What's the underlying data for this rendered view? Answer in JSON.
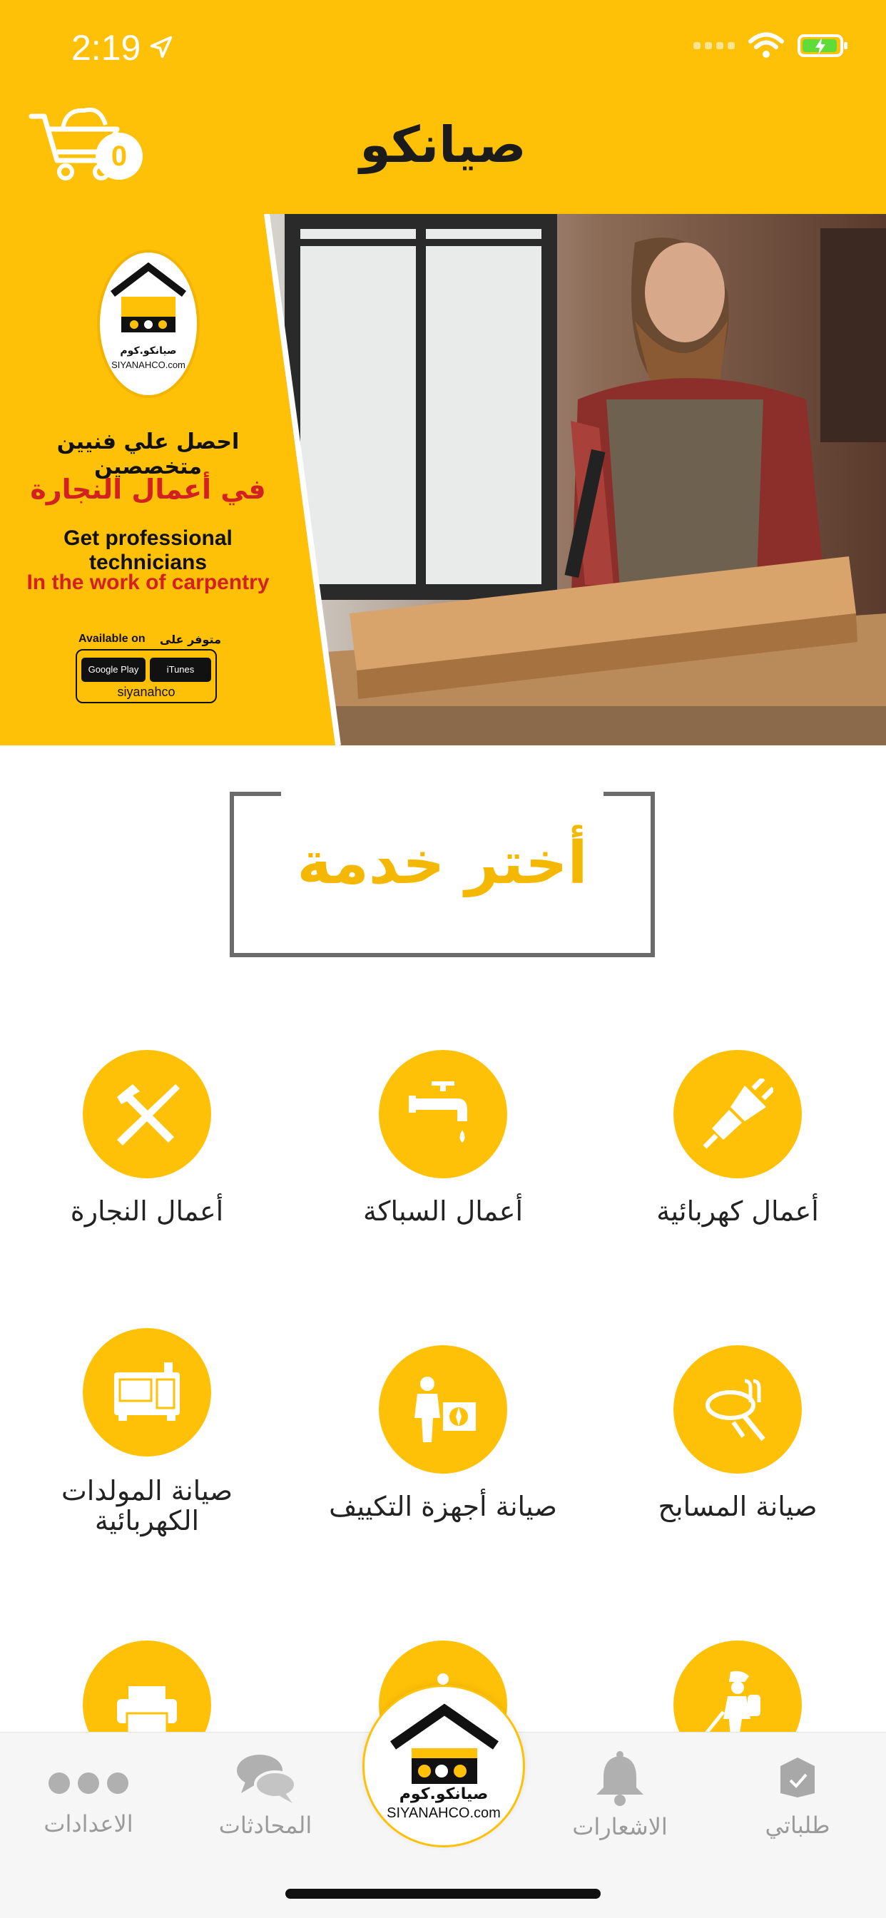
{
  "status_bar": {
    "time": "2:19"
  },
  "header": {
    "title": "صيانكو",
    "cart_count": "0"
  },
  "banner": {
    "logo_text_ar": "صيانكو.كوم",
    "logo_text_en": "SIYANAHCO.com",
    "line_ar_1": "احصل علي فنيين متخصصين",
    "line_ar_2": "في أعمال النجارة",
    "line_en_1": "Get professional technicians",
    "line_en_2": "In the work of carpentry",
    "available_en": "Available on",
    "available_ar": "متوفر على",
    "store_google": "Google Play",
    "store_itunes": "iTunes",
    "store_url": "siyanahco"
  },
  "section": {
    "title": "أختر خدمة"
  },
  "services": [
    {
      "label": "أعمال كهربائية",
      "icon": "electric-plug-icon"
    },
    {
      "label": "أعمال السباكة",
      "icon": "water-tap-icon"
    },
    {
      "label": "أعمال النجارة",
      "icon": "hammer-saw-icon"
    },
    {
      "label": "صيانة المسابح",
      "icon": "pool-maintenance-icon"
    },
    {
      "label": "صيانة أجهزة التكييف",
      "icon": "ac-technician-icon"
    },
    {
      "label": "صيانة المولدات الكهربائية",
      "icon": "generator-icon"
    },
    {
      "label": "",
      "icon": "pest-control-icon"
    },
    {
      "label": "",
      "icon": "service-icon"
    },
    {
      "label": "",
      "icon": "printer-icon"
    }
  ],
  "nav": {
    "orders": "طلباتي",
    "notifications": "الاشعارات",
    "home_logo_ar": "صيانكو.كوم",
    "home_logo_en": "SIYANAHCO.com",
    "chats": "المحادثات",
    "settings": "الاعدادات"
  },
  "colors": {
    "brand_yellow": "#ffc107",
    "title_yellow": "#f5b800",
    "banner_red": "#d32020",
    "nav_gray": "#9a9a9a"
  }
}
